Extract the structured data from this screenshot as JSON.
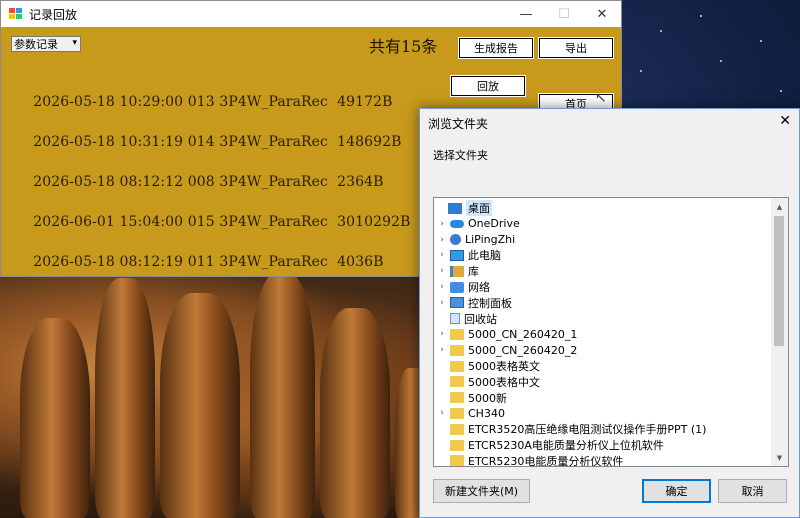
{
  "app": {
    "title": "记录回放",
    "window_controls": {
      "minimize": "—",
      "maximize": "☐",
      "close": "✕"
    },
    "filter_select": {
      "value": "参数记录"
    },
    "count_label": "共有15条",
    "buttons": {
      "generate_report": "生成报告",
      "export": "导出",
      "playback": "回放",
      "home": "首页"
    },
    "records": [
      {
        "date": "2026-05-18",
        "time": "10:29:00",
        "index": "013",
        "type": "3P4W_ParaRec",
        "size": "49172B"
      },
      {
        "date": "2026-05-18",
        "time": "10:31:19",
        "index": "014",
        "type": "3P4W_ParaRec",
        "size": "148692B"
      },
      {
        "date": "2026-05-18",
        "time": "08:12:12",
        "index": "008",
        "type": "3P4W_ParaRec",
        "size": "2364B"
      },
      {
        "date": "2026-06-01",
        "time": "15:04:00",
        "index": "015",
        "type": "3P4W_ParaRec",
        "size": "3010292B"
      },
      {
        "date": "2026-05-18",
        "time": "08:12:19",
        "index": "011",
        "type": "3P4W_ParaRec",
        "size": "4036B"
      }
    ],
    "colors": {
      "background": "#c79a1b",
      "text": "#2a1c00"
    }
  },
  "dialog": {
    "title": "浏览文件夹",
    "close": "✕",
    "prompt": "选择文件夹",
    "tree": [
      {
        "label": "桌面",
        "icon": "desktop-icon",
        "expandable": false,
        "selected": true,
        "level": 0
      },
      {
        "label": "OneDrive",
        "icon": "cloud-icon",
        "expandable": true,
        "level": 1
      },
      {
        "label": "LiPingZhi",
        "icon": "user-icon",
        "expandable": true,
        "level": 1
      },
      {
        "label": "此电脑",
        "icon": "computer-icon",
        "expandable": true,
        "level": 1
      },
      {
        "label": "库",
        "icon": "library-icon",
        "expandable": true,
        "level": 1
      },
      {
        "label": "网络",
        "icon": "network-icon",
        "expandable": true,
        "level": 1
      },
      {
        "label": "控制面板",
        "icon": "control-panel-icon",
        "expandable": true,
        "level": 1
      },
      {
        "label": "回收站",
        "icon": "recycle-bin-icon",
        "expandable": false,
        "level": 1
      },
      {
        "label": "5000_CN_260420_1",
        "icon": "folder-icon",
        "expandable": true,
        "level": 1
      },
      {
        "label": "5000_CN_260420_2",
        "icon": "folder-icon",
        "expandable": true,
        "level": 1
      },
      {
        "label": "5000表格英文",
        "icon": "folder-icon",
        "expandable": false,
        "level": 1
      },
      {
        "label": "5000表格中文",
        "icon": "folder-icon",
        "expandable": false,
        "level": 1
      },
      {
        "label": "5000新",
        "icon": "folder-icon",
        "expandable": false,
        "level": 1
      },
      {
        "label": "CH340",
        "icon": "folder-icon",
        "expandable": true,
        "level": 1
      },
      {
        "label": "ETCR3520高压绝缘电阻测试仪操作手册PPT (1)",
        "icon": "folder-icon",
        "expandable": false,
        "level": 1
      },
      {
        "label": "ETCR5230A电能质量分析仪上位机软件",
        "icon": "folder-icon",
        "expandable": false,
        "level": 1
      },
      {
        "label": "ETCR5230电能质量分析仪软件",
        "icon": "folder-icon",
        "expandable": false,
        "level": 1
      }
    ],
    "buttons": {
      "new_folder": "新建文件夹(M)",
      "ok": "确定",
      "cancel": "取消"
    }
  }
}
